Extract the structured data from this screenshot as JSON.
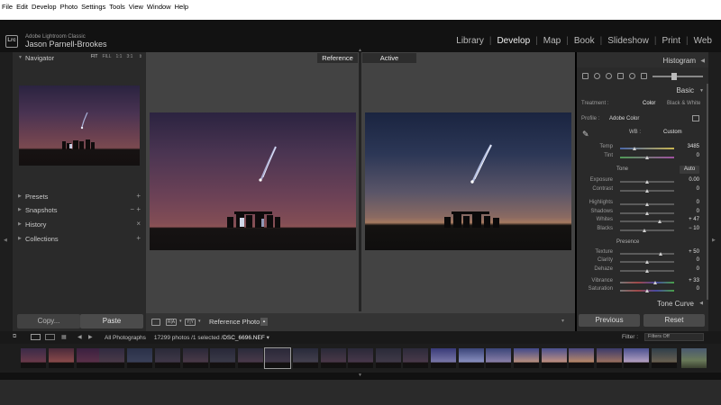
{
  "menubar": [
    "File",
    "Edit",
    "Develop",
    "Photo",
    "Settings",
    "Tools",
    "View",
    "Window",
    "Help"
  ],
  "header": {
    "logo": "Lrc",
    "app_name": "Adobe Lightroom Classic",
    "user_name": "Jason Parnell-Brookes",
    "modules": [
      "Library",
      "Develop",
      "Map",
      "Book",
      "Slideshow",
      "Print",
      "Web"
    ],
    "active_module": "Develop"
  },
  "left_panel": {
    "navigator": {
      "title": "Navigator",
      "zoom_options": [
        "FIT",
        "FILL",
        "1:1",
        "3:1"
      ]
    },
    "panels": [
      {
        "label": "Presets",
        "action": "+"
      },
      {
        "label": "Snapshots",
        "action": "− +"
      },
      {
        "label": "History",
        "action": "×"
      },
      {
        "label": "Collections",
        "action": "+"
      }
    ],
    "copy_label": "Copy...",
    "paste_label": "Paste"
  },
  "center": {
    "reference_label": "Reference",
    "active_label": "Active",
    "toolbar": {
      "reference_photo_label": "Reference Photo :"
    }
  },
  "right_panel": {
    "histogram_title": "Histogram",
    "basic_title": "Basic",
    "treatment_label": "Treatment :",
    "treatment_color": "Color",
    "treatment_bw": "Black & White",
    "profile_label": "Profile :",
    "profile_value": "Adobe Color",
    "wb_label": "WB :",
    "wb_value": "Custom",
    "tone_title": "Tone",
    "auto_label": "Auto",
    "presence_title": "Presence",
    "tone_curve_title": "Tone Curve",
    "previous_label": "Previous",
    "reset_label": "Reset",
    "sliders": {
      "temp": {
        "label": "Temp",
        "value": "3485",
        "pos": 0.28
      },
      "tint": {
        "label": "Tint",
        "value": "0",
        "pos": 0.5
      },
      "exposure": {
        "label": "Exposure",
        "value": "0.00",
        "pos": 0.5
      },
      "contrast": {
        "label": "Contrast",
        "value": "0",
        "pos": 0.5
      },
      "highlights": {
        "label": "Highlights",
        "value": "0",
        "pos": 0.5
      },
      "shadows": {
        "label": "Shadows",
        "value": "0",
        "pos": 0.5
      },
      "whites": {
        "label": "Whites",
        "value": "+ 47",
        "pos": 0.74
      },
      "blacks": {
        "label": "Blacks",
        "value": "− 10",
        "pos": 0.45
      },
      "texture": {
        "label": "Texture",
        "value": "+ 50",
        "pos": 0.75
      },
      "clarity": {
        "label": "Clarity",
        "value": "0",
        "pos": 0.5
      },
      "dehaze": {
        "label": "Dehaze",
        "value": "0",
        "pos": 0.5
      },
      "vibrance": {
        "label": "Vibrance",
        "value": "+ 33",
        "pos": 0.66
      },
      "saturation": {
        "label": "Saturation",
        "value": "0",
        "pos": 0.5
      }
    }
  },
  "filmstrip_bar": {
    "source": "All Photographs",
    "count": "17299 photos /1 selected /",
    "filename": "DSC_6696.NEF",
    "filter_label": "Filter :",
    "filter_value": "Filters Off"
  },
  "colors": {
    "panel_bg": "#2a2a2a",
    "center_bg": "#434343",
    "header_bg": "#121212",
    "active_text": "#ededed"
  }
}
